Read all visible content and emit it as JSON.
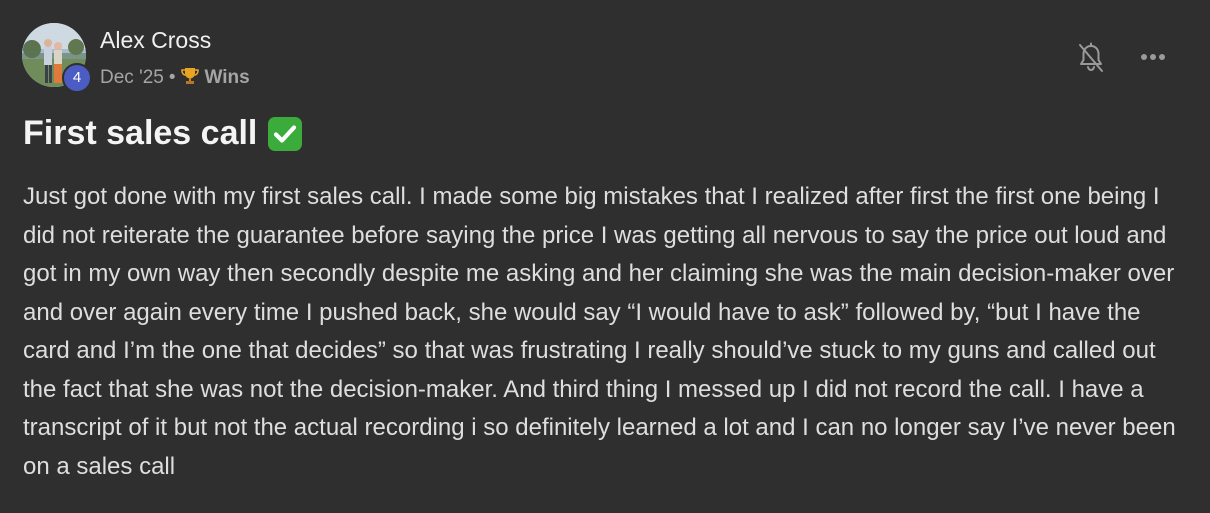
{
  "author": {
    "name": "Alex Cross",
    "level": "4",
    "avatar_alt": "avatar"
  },
  "meta": {
    "date": "Dec '25",
    "separator": "•",
    "category": "Wins",
    "category_icon": "trophy-icon"
  },
  "actions": {
    "notifications_icon": "bell-off-icon",
    "more_icon": "more-horizontal-icon"
  },
  "post": {
    "title": "First sales call",
    "title_emoji_icon": "check-mark-button-icon",
    "body": "Just got done with my first sales call. I made some big mistakes that I realized after first the first one being I did not reiterate the guarantee before saying the price I was getting all nervous to say the price out loud and got in my own way then secondly despite me asking and her claiming she was the main decision-maker over and over again every time I pushed back, she would say “I would have to ask” followed by, “but I have the card and I’m the one that decides” so that was frustrating I really should’ve stuck to my guns and called out the fact that she was not the decision-maker. And third thing I messed up I did not record the call. I have a transcript of it but not the actual recording i so definitely learned a lot and I can no longer say I’ve never been on a sales call"
  },
  "colors": {
    "background": "#2f2f2f",
    "level_badge": "#4b5cc4",
    "check_green": "#3bab3b",
    "trophy_gold": "#e8a524"
  }
}
